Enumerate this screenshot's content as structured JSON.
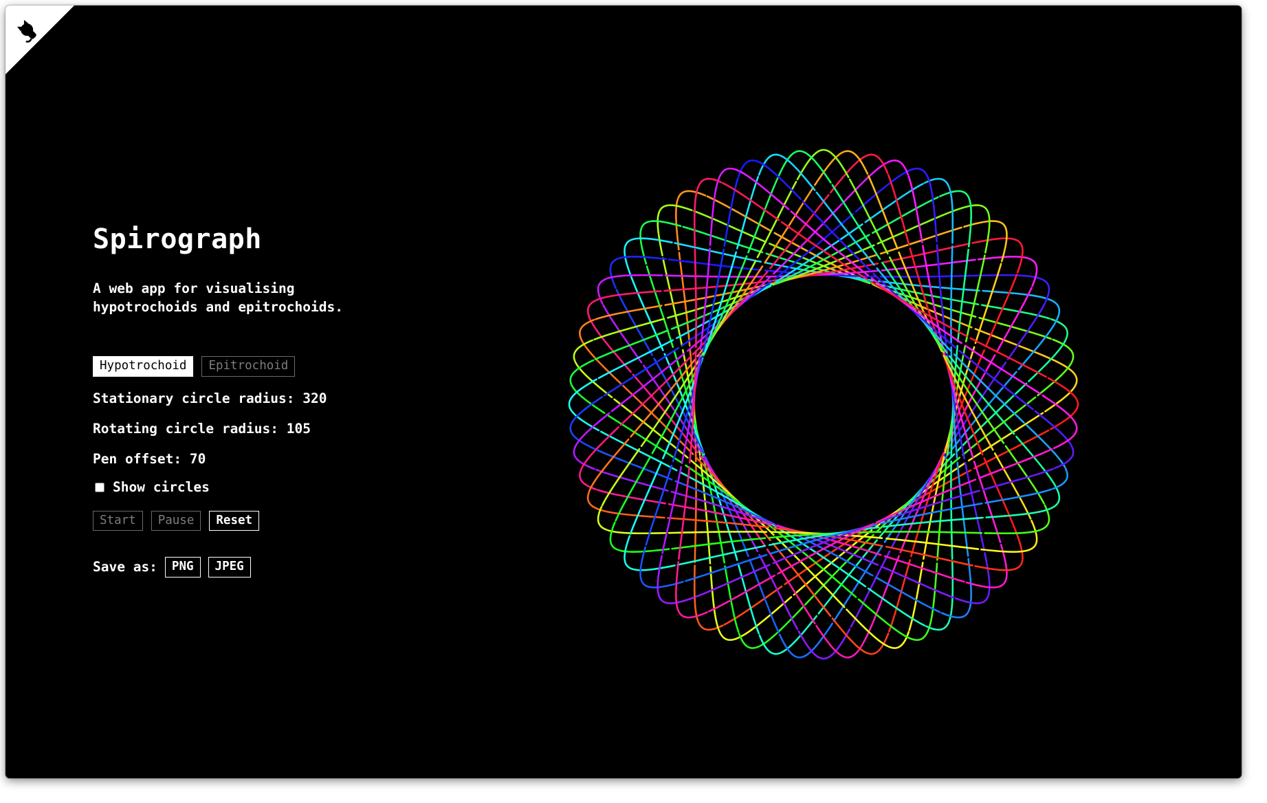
{
  "app": {
    "title": "Spirograph",
    "subtitle": "A web app for visualising hypotrochoids and epitrochoids."
  },
  "icons": {
    "corner": "github-octocat-icon"
  },
  "mode_tabs": [
    {
      "label": "Hypotrochoid",
      "selected": true
    },
    {
      "label": "Epitrochoid",
      "selected": false
    }
  ],
  "params": {
    "stationary": {
      "label": "Stationary circle radius:",
      "value": "320"
    },
    "rotating": {
      "label": "Rotating circle radius:",
      "value": "105"
    },
    "pen": {
      "label": "Pen offset:",
      "value": "70"
    }
  },
  "show_circles": {
    "label": "Show circles",
    "checked": false
  },
  "controls": {
    "start": "Start",
    "pause": "Pause",
    "reset": "Reset"
  },
  "save": {
    "label": "Save as:",
    "png": "PNG",
    "jpeg": "JPEG"
  },
  "colors": {
    "background": "#000000",
    "text": "#ffffff",
    "inactive": "#7d7d7d"
  },
  "spiro": {
    "R": 320,
    "r": 105,
    "d": 70
  }
}
